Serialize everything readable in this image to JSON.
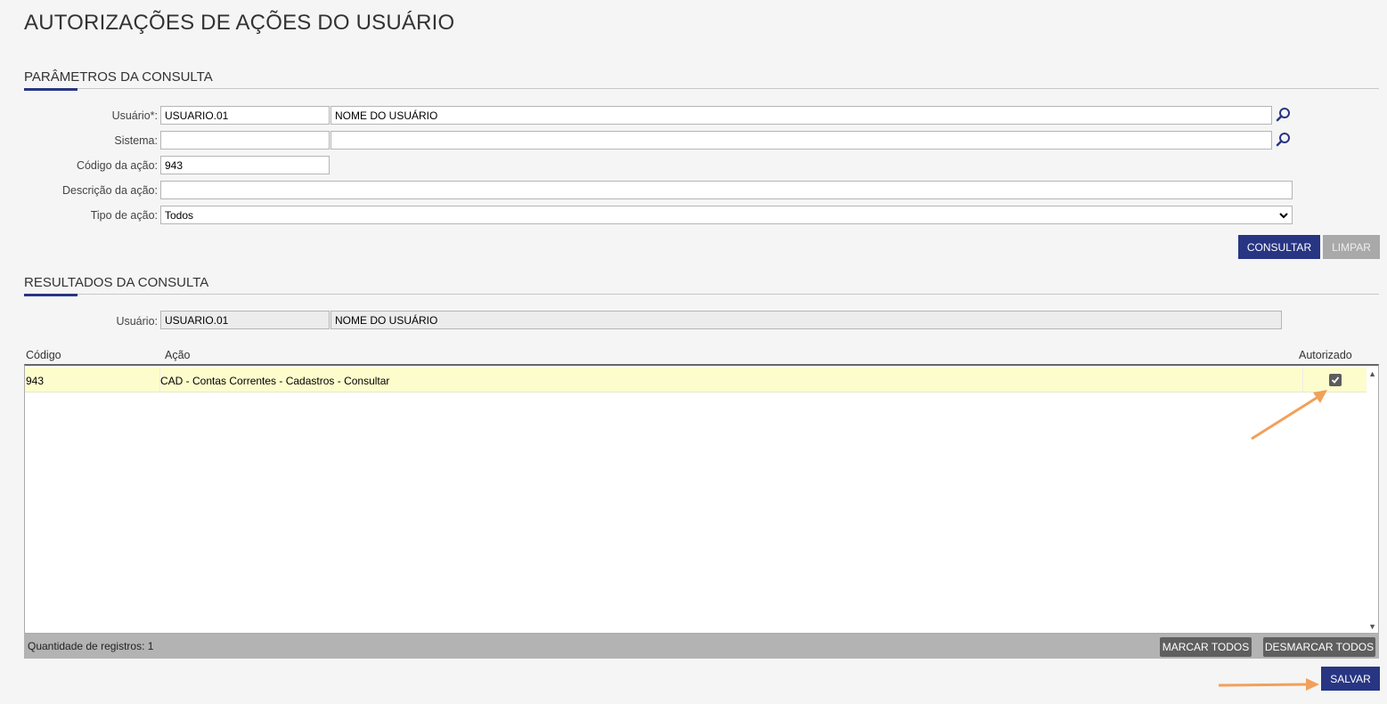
{
  "page": {
    "title": "AUTORIZAÇÕES DE AÇÕES DO USUÁRIO"
  },
  "params": {
    "section_title": "PARÂMETROS DA CONSULTA",
    "usuario_label": "Usuário*:",
    "usuario_code": "USUARIO.01",
    "usuario_name": "NOME DO USUÁRIO",
    "sistema_label": "Sistema:",
    "sistema_code": "",
    "sistema_name": "",
    "codigo_label": "Código da ação:",
    "codigo_value": "943",
    "descricao_label": "Descrição da ação:",
    "descricao_value": "",
    "tipo_label": "Tipo de ação:",
    "tipo_value": "Todos",
    "consultar_label": "CONSULTAR",
    "limpar_label": "LIMPAR"
  },
  "results": {
    "section_title": "RESULTADOS DA CONSULTA",
    "usuario_label": "Usuário:",
    "usuario_code": "USUARIO.01",
    "usuario_name": "NOME DO USUÁRIO",
    "columns": {
      "codigo": "Código",
      "acao": "Ação",
      "autorizado": "Autorizado"
    },
    "rows": [
      {
        "codigo": "943",
        "acao": "CAD - Contas Correntes - Cadastros - Consultar",
        "autorizado": true
      }
    ],
    "count_text": "Quantidade de registros: 1",
    "marcar_label": "MARCAR TODOS",
    "desmarcar_label": "DESMARCAR TODOS",
    "salvar_label": "SALVAR"
  },
  "colors": {
    "primary": "#283583",
    "annotation_arrow": "#f2a05a",
    "row_highlight": "#fdfccc"
  },
  "icons": {
    "lookup": "search-icon",
    "dropdown": "chevron-down-icon",
    "checkbox": "checkmark-icon"
  }
}
